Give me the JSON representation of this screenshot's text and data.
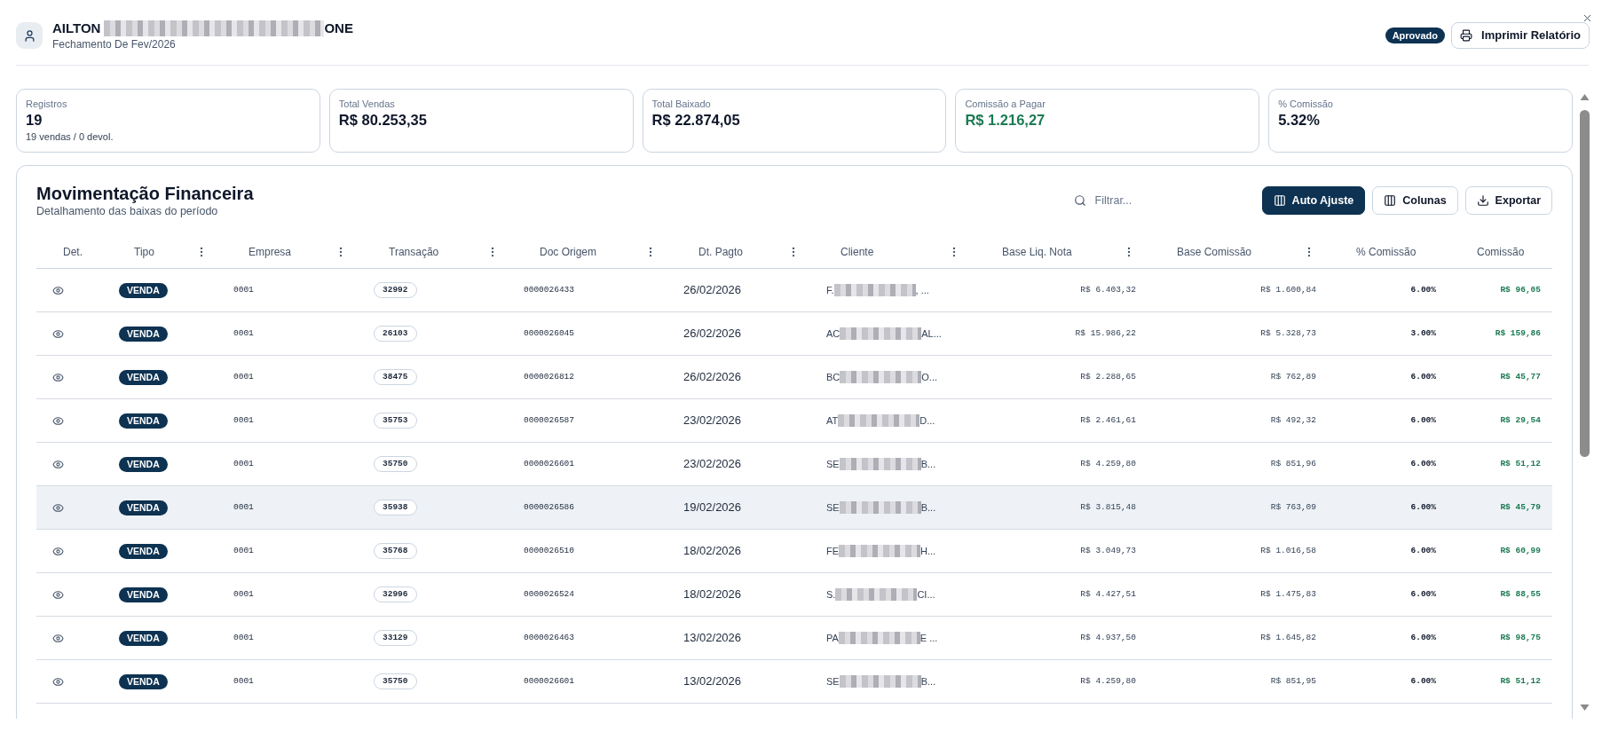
{
  "header": {
    "name_start": "AILTON",
    "name_end": "ONE",
    "subtitle": "Fechamento De Fev/2026",
    "status": "Aprovado",
    "print_button": "Imprimir Relatório"
  },
  "stats": [
    {
      "label": "Registros",
      "value": "19",
      "note": "19 vendas / 0 devol.",
      "positive": false
    },
    {
      "label": "Total Vendas",
      "value": "R$ 80.253,35",
      "positive": false
    },
    {
      "label": "Total Baixado",
      "value": "R$ 22.874,05",
      "positive": false
    },
    {
      "label": "Comissão a Pagar",
      "value": "R$ 1.216,27",
      "positive": true
    },
    {
      "label": "% Comissão",
      "value": "5.32%",
      "positive": false
    }
  ],
  "movements": {
    "title": "Movimentação Financeira",
    "subtitle": "Detalhamento das baixas do período",
    "filter": {
      "placeholder": "Filtrar..."
    },
    "buttons": [
      {
        "label": "Auto Ajuste",
        "kind": "primary"
      },
      {
        "label": "Colunas",
        "kind": "secondary"
      },
      {
        "label": "Exportar",
        "kind": "secondary"
      }
    ],
    "columns": [
      {
        "label": "Det.",
        "menu": false
      },
      {
        "label": "Tipo",
        "menu": true
      },
      {
        "label": "Empresa",
        "menu": true
      },
      {
        "label": "Transação",
        "menu": true
      },
      {
        "label": "Doc Origem",
        "menu": true
      },
      {
        "label": "Dt. Pagto",
        "menu": true
      },
      {
        "label": "Cliente",
        "menu": true
      },
      {
        "label": "Base Liq. Nota",
        "menu": true
      },
      {
        "label": "Base Comissão",
        "menu": true
      },
      {
        "label": "% Comissão",
        "menu": false
      },
      {
        "label": "Comissão",
        "menu": false
      }
    ],
    "rows": [
      {
        "type": "VENDA",
        "company": "0001",
        "transaction": "32992",
        "document": "0000026433",
        "date": "26/02/2026",
        "client_start": "F.",
        "client_end": ", ...",
        "base_net": "R$ 6.403,32",
        "base_commission": "R$ 1.600,84",
        "rate": "6.00%",
        "commission": "R$ 96,05",
        "highlighted": false
      },
      {
        "type": "VENDA",
        "company": "0001",
        "transaction": "26103",
        "document": "0000026045",
        "date": "26/02/2026",
        "client_start": "AC",
        "client_end": "AL...",
        "base_net": "R$ 15.986,22",
        "base_commission": "R$ 5.328,73",
        "rate": "3.00%",
        "commission": "R$ 159,86",
        "highlighted": false
      },
      {
        "type": "VENDA",
        "company": "0001",
        "transaction": "38475",
        "document": "0000026812",
        "date": "26/02/2026",
        "client_start": "BC",
        "client_end": "O...",
        "base_net": "R$ 2.288,65",
        "base_commission": "R$ 762,89",
        "rate": "6.00%",
        "commission": "R$ 45,77",
        "highlighted": false
      },
      {
        "type": "VENDA",
        "company": "0001",
        "transaction": "35753",
        "document": "0000026587",
        "date": "23/02/2026",
        "client_start": "AT",
        "client_end": "D...",
        "base_net": "R$ 2.461,61",
        "base_commission": "R$ 492,32",
        "rate": "6.00%",
        "commission": "R$ 29,54",
        "highlighted": false
      },
      {
        "type": "VENDA",
        "company": "0001",
        "transaction": "35750",
        "document": "0000026601",
        "date": "23/02/2026",
        "client_start": "SE",
        "client_end": "B...",
        "base_net": "R$ 4.259,80",
        "base_commission": "R$ 851,96",
        "rate": "6.00%",
        "commission": "R$ 51,12",
        "highlighted": false
      },
      {
        "type": "VENDA",
        "company": "0001",
        "transaction": "35938",
        "document": "0000026586",
        "date": "19/02/2026",
        "client_start": "SE",
        "client_end": "B...",
        "base_net": "R$ 3.815,48",
        "base_commission": "R$ 763,09",
        "rate": "6.00%",
        "commission": "R$ 45,79",
        "highlighted": true
      },
      {
        "type": "VENDA",
        "company": "0001",
        "transaction": "35768",
        "document": "0000026510",
        "date": "18/02/2026",
        "client_start": "FE",
        "client_end": "H...",
        "base_net": "R$ 3.049,73",
        "base_commission": "R$ 1.016,58",
        "rate": "6.00%",
        "commission": "R$ 60,99",
        "highlighted": false
      },
      {
        "type": "VENDA",
        "company": "0001",
        "transaction": "32996",
        "document": "0000026524",
        "date": "18/02/2026",
        "client_start": "S.",
        "client_end": "CI...",
        "base_net": "R$ 4.427,51",
        "base_commission": "R$ 1.475,83",
        "rate": "6.00%",
        "commission": "R$ 88,55",
        "highlighted": false
      },
      {
        "type": "VENDA",
        "company": "0001",
        "transaction": "33129",
        "document": "0000026463",
        "date": "13/02/2026",
        "client_start": "PA",
        "client_end": "E ...",
        "base_net": "R$ 4.937,50",
        "base_commission": "R$ 1.645,82",
        "rate": "6.00%",
        "commission": "R$ 98,75",
        "highlighted": false
      },
      {
        "type": "VENDA",
        "company": "0001",
        "transaction": "35750",
        "document": "0000026601",
        "date": "13/02/2026",
        "client_start": "SE",
        "client_end": "B...",
        "base_net": "R$ 4.259,80",
        "base_commission": "R$ 851,95",
        "rate": "6.00%",
        "commission": "R$ 51,12",
        "highlighted": false
      }
    ]
  }
}
